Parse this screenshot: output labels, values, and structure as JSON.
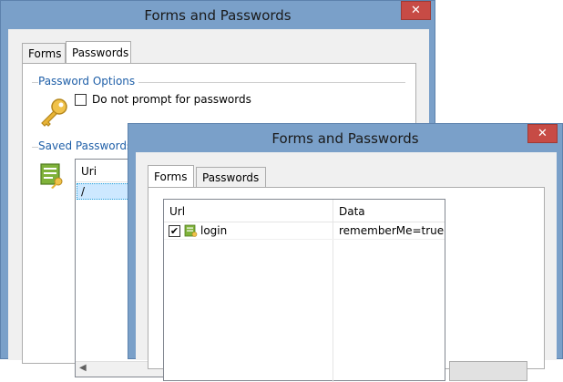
{
  "back_window": {
    "title": "Forms and Passwords",
    "close_glyph": "✕",
    "tabs": [
      {
        "label": "Forms",
        "selected": false
      },
      {
        "label": "Passwords",
        "selected": true
      }
    ],
    "password_options": {
      "group_label": "Password Options",
      "checkbox_label": "Do not prompt for passwords",
      "checked": false,
      "icon": "key-icon"
    },
    "saved_passwords": {
      "group_label": "Saved Passwords",
      "icon": "form-key-icon",
      "columns": [
        "Uri"
      ],
      "rows": [
        {
          "uri": "/"
        }
      ]
    }
  },
  "front_window": {
    "title": "Forms and Passwords",
    "close_glyph": "✕",
    "tabs": [
      {
        "label": "Forms",
        "selected": true
      },
      {
        "label": "Passwords",
        "selected": false
      }
    ],
    "forms_list": {
      "columns": [
        "Url",
        "Data"
      ],
      "rows": [
        {
          "checked": true,
          "icon": "form-key-icon",
          "url": "login",
          "data": "rememberMe=true&u"
        }
      ]
    }
  },
  "colors": {
    "title_bar": "#7aa0c9",
    "close_button": "#c74b45",
    "group_label": "#1f5fa8",
    "selection": "#cde8ff"
  }
}
